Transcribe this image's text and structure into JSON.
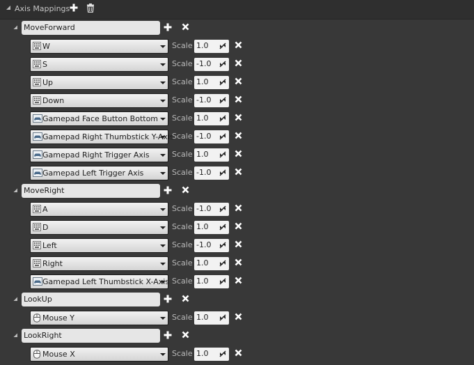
{
  "header": {
    "title": "Axis Mappings"
  },
  "scale_label": "Scale",
  "groups": [
    {
      "name": "MoveForward",
      "mappings": [
        {
          "key": "W",
          "scale": "1.0",
          "icon": "keyboard-icon"
        },
        {
          "key": "S",
          "scale": "-1.0",
          "icon": "keyboard-icon"
        },
        {
          "key": "Up",
          "scale": "1.0",
          "icon": "keyboard-icon"
        },
        {
          "key": "Down",
          "scale": "-1.0",
          "icon": "keyboard-icon"
        },
        {
          "key": "Gamepad Face Button Bottom",
          "scale": "1.0",
          "icon": "gamepad-icon"
        },
        {
          "key": "Gamepad Right Thumbstick Y-Axis",
          "scale": "-1.0",
          "icon": "gamepad-icon"
        },
        {
          "key": "Gamepad Right Trigger Axis",
          "scale": "1.0",
          "icon": "gamepad-icon"
        },
        {
          "key": "Gamepad Left Trigger Axis",
          "scale": "-1.0",
          "icon": "gamepad-icon"
        }
      ]
    },
    {
      "name": "MoveRight",
      "mappings": [
        {
          "key": "A",
          "scale": "-1.0",
          "icon": "keyboard-icon"
        },
        {
          "key": "D",
          "scale": "1.0",
          "icon": "keyboard-icon"
        },
        {
          "key": "Left",
          "scale": "-1.0",
          "icon": "keyboard-icon"
        },
        {
          "key": "Right",
          "scale": "1.0",
          "icon": "keyboard-icon"
        },
        {
          "key": "Gamepad Left Thumbstick X-Axis",
          "scale": "1.0",
          "icon": "gamepad-icon"
        }
      ]
    },
    {
      "name": "LookUp",
      "mappings": [
        {
          "key": "Mouse Y",
          "scale": "1.0",
          "icon": "mouse-icon"
        }
      ]
    },
    {
      "name": "LookRight",
      "mappings": [
        {
          "key": "Mouse X",
          "scale": "1.0",
          "icon": "mouse-icon"
        }
      ]
    }
  ]
}
